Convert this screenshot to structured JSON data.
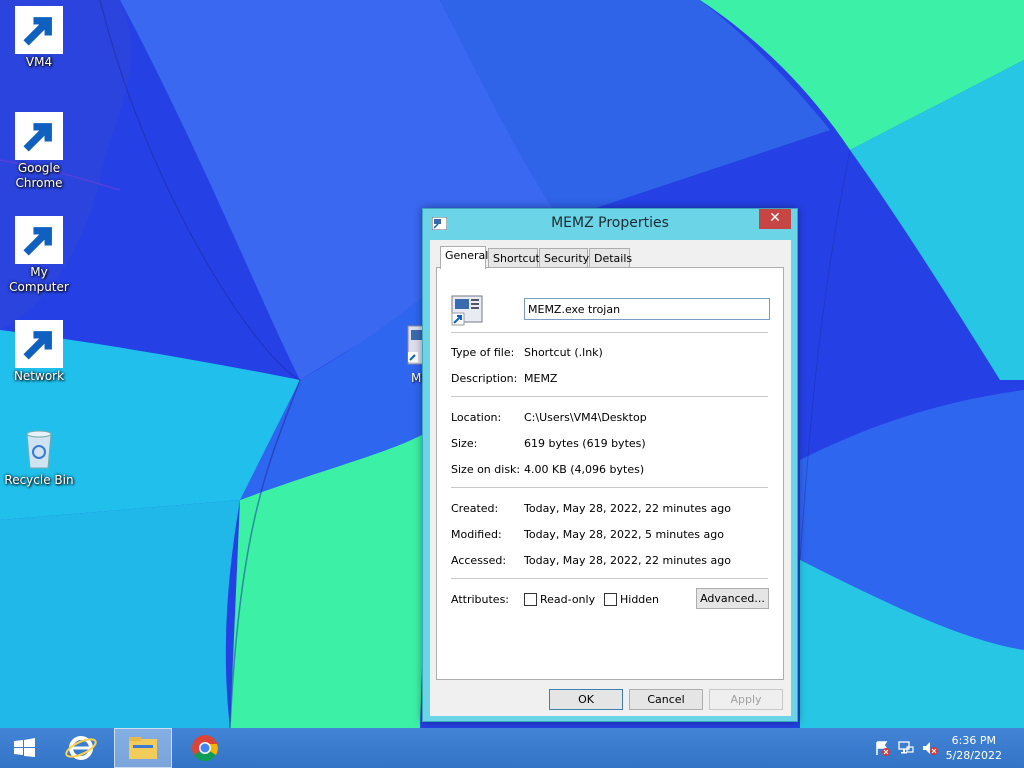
{
  "desktop": {
    "icons": [
      {
        "label": "VM4",
        "icon": "user-folder-icon"
      },
      {
        "label": "Google Chrome",
        "icon": "chrome-icon"
      },
      {
        "label": "My Computer",
        "icon": "computer-icon"
      },
      {
        "label": "Network",
        "icon": "network-icon"
      },
      {
        "label": "Recycle Bin",
        "icon": "recycle-bin-icon"
      }
    ],
    "hidden_icon_label": "M"
  },
  "dialog": {
    "title": "MEMZ Properties",
    "close": "✕",
    "tabs": [
      "General",
      "Shortcut",
      "Security",
      "Details"
    ],
    "active_tab": "General",
    "name_value": "MEMZ.exe trojan",
    "type_label": "Type of file:",
    "type_value": "Shortcut (.lnk)",
    "description_label": "Description:",
    "description_value": "MEMZ",
    "location_label": "Location:",
    "location_value": "C:\\Users\\VM4\\Desktop",
    "size_label": "Size:",
    "size_value": "619 bytes (619 bytes)",
    "size_on_disk_label": "Size on disk:",
    "size_on_disk_value": "4.00 KB (4,096 bytes)",
    "created_label": "Created:",
    "created_value": "Today, May 28, 2022, 22 minutes ago",
    "modified_label": "Modified:",
    "modified_value": "Today, May 28, 2022, 5 minutes ago",
    "accessed_label": "Accessed:",
    "accessed_value": "Today, May 28, 2022, 22 minutes ago",
    "attributes_label": "Attributes:",
    "readonly_label": "Read-only",
    "readonly_checked": false,
    "hidden_label": "Hidden",
    "hidden_checked": false,
    "advanced_label": "Advanced...",
    "ok_label": "OK",
    "cancel_label": "Cancel",
    "apply_label": "Apply"
  },
  "taskbar": {
    "pinned": [
      "start-icon",
      "internet-explorer-icon",
      "file-explorer-icon",
      "chrome-icon"
    ],
    "tray": [
      "action-center-flag-icon",
      "network-tray-icon",
      "volume-muted-icon"
    ],
    "time": "6:36 PM",
    "date": "5/28/2022"
  },
  "colors": {
    "close_button": "#c74545",
    "dialog_frame": "#6bd4e6",
    "taskbar": "#3576cc"
  }
}
